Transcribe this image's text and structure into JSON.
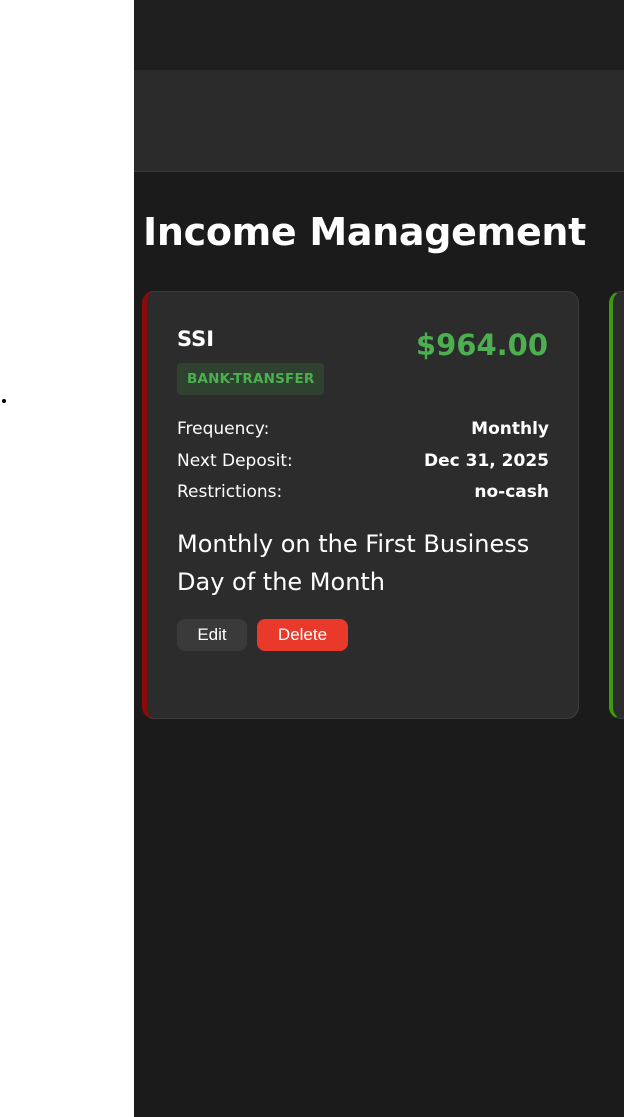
{
  "page": {
    "title": "Income Management"
  },
  "incomes": [
    {
      "name": "SSI",
      "amount": "$964.00",
      "method": "BANK-TRANSFER",
      "details": [
        {
          "label": "Frequency:",
          "value": "Monthly"
        },
        {
          "label": "Next Deposit:",
          "value": "Dec 31, 2025"
        },
        {
          "label": "Restrictions:",
          "value": "no-cash"
        }
      ],
      "schedule": "Monthly on the First Business Day of the Month",
      "actions": {
        "edit_label": "Edit",
        "delete_label": "Delete"
      },
      "accent_color": "#8b0b0b"
    },
    {
      "accent_color": "#3d9a0f"
    }
  ],
  "colors": {
    "background": "#1b1b1b",
    "card": "#2c2c2c",
    "amount": "#4caf50",
    "delete": "#e8392b"
  }
}
